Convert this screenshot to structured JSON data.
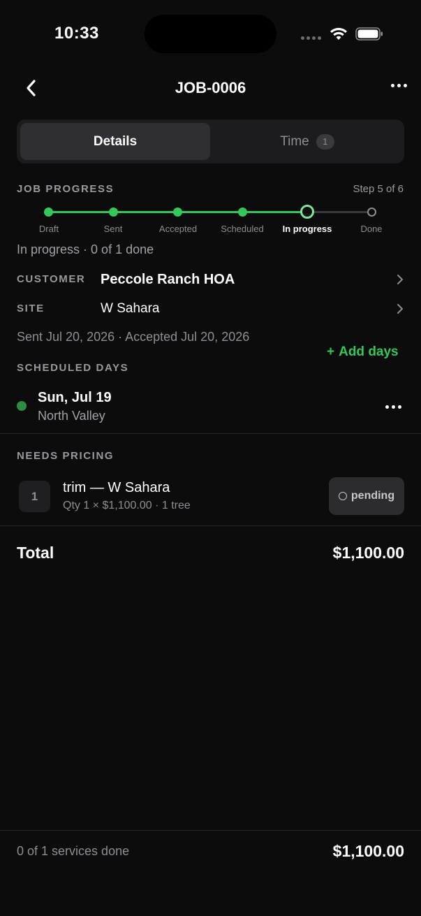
{
  "status_bar": {
    "time": "10:33"
  },
  "header": {
    "title": "JOB-0006"
  },
  "tabs": [
    {
      "label": "Details",
      "active": true
    },
    {
      "label": "Time",
      "badge": "1",
      "active": false
    }
  ],
  "progress": {
    "label": "JOB PROGRESS",
    "step_text": "Step 5 of 6",
    "steps": [
      "Draft",
      "Sent",
      "Accepted",
      "Scheduled",
      "In progress",
      "Done"
    ],
    "current_index": 4,
    "summary": "In progress · 0 of 1 done"
  },
  "customer": {
    "label": "CUSTOMER",
    "value": "Peccole Ranch HOA"
  },
  "site": {
    "label": "SITE",
    "value": "W Sahara"
  },
  "sent_line": "Sent Jul 20, 2026 · Accepted Jul 20, 2026",
  "scheduled": {
    "label": "SCHEDULED DAYS",
    "add_label": "Add days",
    "add_icon": "+",
    "days": [
      {
        "title": "Sun, Jul 19",
        "subtitle": "North Valley"
      }
    ]
  },
  "pricing": {
    "label": "NEEDS PRICING",
    "items": [
      {
        "qty": "1",
        "title": "trim — W Sahara",
        "subtitle": "Qty 1 × $1,100.00 · 1 tree",
        "status": "pending"
      }
    ]
  },
  "total": {
    "label": "Total",
    "value": "$1,100.00"
  },
  "footer": {
    "summary": "0 of 1 services done",
    "amount": "$1,100.00"
  },
  "colors": {
    "accent": "#34c759",
    "background": "#0c0c0c",
    "surface": "#1c1c1e"
  }
}
